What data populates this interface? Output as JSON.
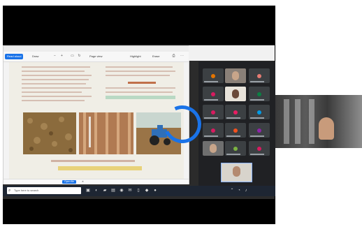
{
  "browser": {
    "title": "",
    "toolbar": {
      "read_aloud": "Read aloud",
      "draw": "Draw",
      "highlight": "Highlight",
      "erase": "Erase",
      "page_view": "Page view"
    },
    "download_bar": {
      "file_text": "",
      "open_button": "Open file",
      "close": "✕"
    }
  },
  "meeting": {
    "self_name": "",
    "remote_name": ""
  },
  "taskbar": {
    "search_placeholder": "Type here to search",
    "time": "",
    "date": ""
  },
  "icons": [
    "search-icon",
    "close-icon",
    "menu-icon",
    "chevron-icon",
    "mic-icon",
    "camera-icon",
    "windows-icon",
    "chrome-icon",
    "folder-icon",
    "edge-icon",
    "mail-icon",
    "wifi-icon",
    "volume-icon",
    "battery-icon"
  ]
}
